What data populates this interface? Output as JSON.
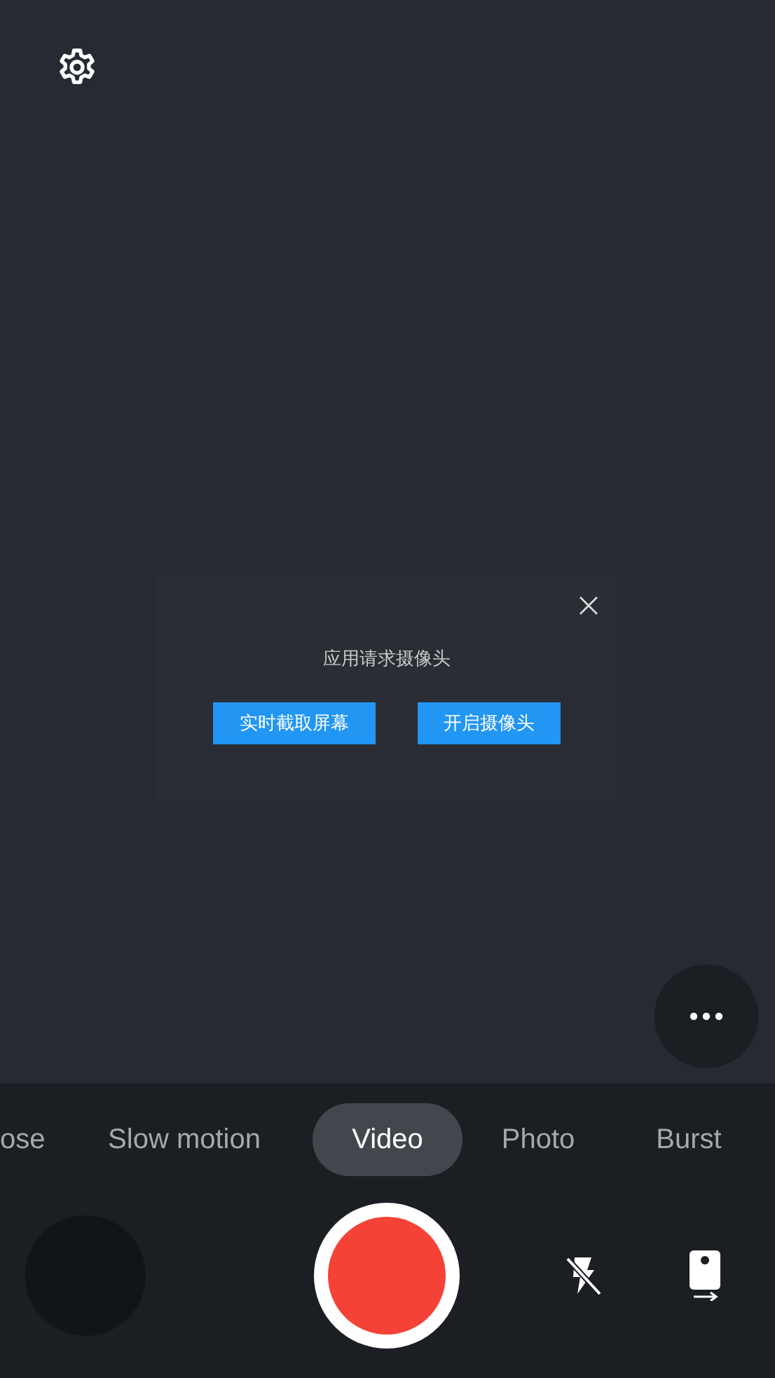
{
  "dialog": {
    "message": "应用请求摄像头",
    "buttons": [
      "实时截取屏幕",
      "开启摄像头"
    ]
  },
  "modes": [
    {
      "label": "ose",
      "selected": false
    },
    {
      "label": "Slow motion",
      "selected": false
    },
    {
      "label": "Video",
      "selected": true
    },
    {
      "label": "Photo",
      "selected": false
    },
    {
      "label": "Burst",
      "selected": false
    }
  ],
  "flash_on": false
}
